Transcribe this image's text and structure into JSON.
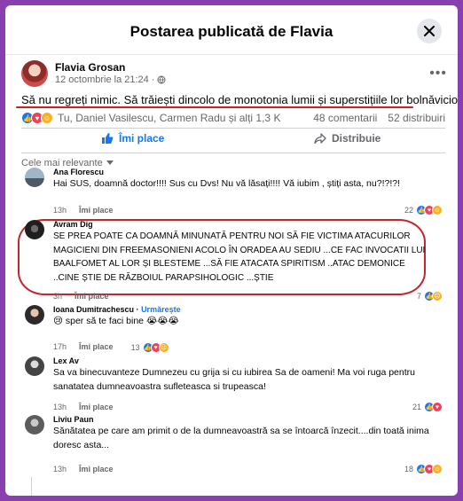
{
  "header": {
    "title": "Postarea publicată de Flavia"
  },
  "post": {
    "author": "Flavia Grosan",
    "date": "12 octombrie la 21:24",
    "separator": "·",
    "text": "Să nu regreți nimic. Să trăiești dincolo de monotonia lumii și superstițiile lor bolnăvicioase.",
    "reactions_summary": "Tu, Daniel Vasilescu, Carmen Radu și alți 1,3 K",
    "comments_count": "48 comentarii",
    "shares_count": "52 distribuiri"
  },
  "actions": {
    "like": "Îmi place",
    "share": "Distribuie"
  },
  "sort": {
    "label": "Cele mai relevante"
  },
  "comments": [
    {
      "name": "Ana Florescu",
      "text": "Hai SUS, doamnă doctor!!!! Sus cu Dvs! Nu vă lăsați!!!! Vă iubim , știți asta, nu?!?!?!",
      "time": "13h",
      "like": "Îmi place",
      "count": "22"
    },
    {
      "name": "Avram Dig",
      "text": "SE PREA POATE CA DOAMNĂ MINUNATĂ PENTRU NOI SĂ FIE VICTIMA ATACURILOR MAGICIENI DIN FREEMASONIENI ACOLO ÎN ORADEA AU SEDIU ...CE FAC INVOCATII LUI BAALFOMET AL LOR ȘI BLESTEME ...SĂ FIE ATACATA SPIRITISM ..ATAC DEMONICE ..CINE ȘTIE DE RĂZBOIUL PARAPSIHOLOGIC ...ȘTIE",
      "time": "3h",
      "like": "Îmi place",
      "count": "7"
    },
    {
      "name": "Ioana Dumitrachescu",
      "follow": "Urmărește",
      "text": "sper să te faci bine",
      "time": "17h",
      "like": "Îmi place",
      "count": "13"
    },
    {
      "name": "Lex Av",
      "text": "Sa va binecuvanteze Dumnezeu cu grija si cu iubirea Sa de oameni! Ma voi ruga pentru sanatatea dumneavoastra sufleteasca si trupeasca!",
      "time": "13h",
      "like": "Îmi place",
      "count": "21"
    },
    {
      "name": "Liviu Paun",
      "text": "Sănătatea pe care am primit o de la dumneavoastră sa se întoarcă înzecit....din toată inima doresc asta...",
      "time": "13h",
      "like": "Îmi place",
      "count": "18"
    }
  ],
  "colors": {
    "accent": "#1877f2",
    "highlight": "#c4262c",
    "background": "#8a3fb0"
  }
}
